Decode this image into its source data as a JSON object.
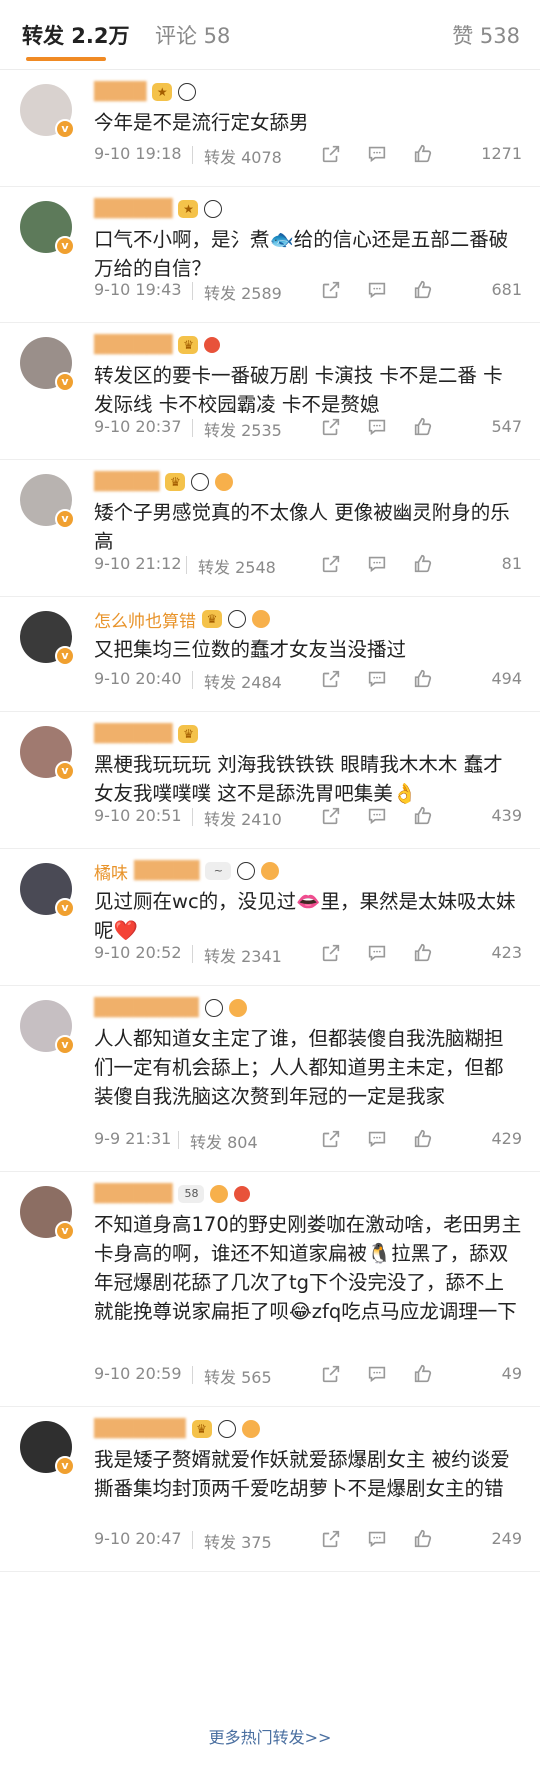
{
  "tabs": {
    "reposts": "转发 2.2万",
    "comments": "评论 58",
    "likes": "赞 538"
  },
  "colors": {
    "accent": "#f08a24",
    "username": "#e8932a",
    "meta": "#8a8a8a",
    "link": "#4a6fa0"
  },
  "items": [
    {
      "username": "",
      "text": "今年是不是流行定女舔男",
      "time": "9-10 19:18",
      "reposts": "转发 4078",
      "likes": "1271",
      "avatar_color": "#d9d2cf"
    },
    {
      "username": "",
      "text": "口气不小啊，是氵煮🐟给的信心还是五部二番破万给的自信？",
      "time": "9-10 19:43",
      "reposts": "转发 2589",
      "likes": "681",
      "avatar_color": "#5d7a5a"
    },
    {
      "username": "",
      "text": "转发区的要卡一番破万剧 卡演技 卡不是二番 卡发际线 卡不校园霸凌 卡不是赘媳",
      "time": "9-10 20:37",
      "reposts": "转发 2535",
      "likes": "547",
      "avatar_color": "#9a8f8a"
    },
    {
      "username": "",
      "text": "矮个子男感觉真的不太像人 更像被幽灵附身的乐高",
      "time": "9-10 21:12",
      "reposts": "转发 2548",
      "likes": "81",
      "avatar_color": "#b8b3b0"
    },
    {
      "username": "怎么帅也算错",
      "text": "又把集均三位数的蠢才女友当没播过",
      "time": "9-10 20:40",
      "reposts": "转发 2484",
      "likes": "494",
      "avatar_color": "#3a3a3a"
    },
    {
      "username": "",
      "text": "黑梗我玩玩玩 刘海我铁铁铁 眼睛我木木木 蠢才女友我噗噗噗 这不是舔洗胃吧集美👌",
      "time": "9-10 20:51",
      "reposts": "转发 2410",
      "likes": "439",
      "avatar_color": "#a07a70"
    },
    {
      "username": "橘味",
      "text": "见过厕在wc的，没见过👄里，果然是太妹吸太妹呢❤️",
      "time": "9-10 20:52",
      "reposts": "转发 2341",
      "likes": "423",
      "avatar_color": "#4a4a55"
    },
    {
      "username": "",
      "text": "人人都知道女主定了谁，但都装傻自我洗脑糊担们一定有机会舔上；人人都知道男主未定，但都装傻自我洗脑这次赘到年冠的一定是我家",
      "time": "9-9 21:31",
      "reposts": "转发 804",
      "likes": "429",
      "avatar_color": "#c6bfc2"
    },
    {
      "username": "",
      "text": "不知道身高170的野史刚娄咖在激动啥，老田男主卡身高的啊，谁还不知道家扁被🐧拉黑了，舔双年冠爆剧花舔了几次了tg下个没完没了，舔不上就能挽尊说家扁拒了呗😂zfq吃点马应龙调理一下",
      "time": "9-10 20:59",
      "reposts": "转发 565",
      "likes": "49",
      "avatar_color": "#8c6e63"
    },
    {
      "username": "",
      "text": "我是矮子赘婿就爱作妖就爱舔爆剧女主 被约谈爱撕番集均封顶两千爱吃胡萝卜不是爆剧女主的错",
      "time": "9-10 20:47",
      "reposts": "转发 375",
      "likes": "249",
      "avatar_color": "#2f2f2f"
    }
  ],
  "more_link": "更多热门转发>>"
}
